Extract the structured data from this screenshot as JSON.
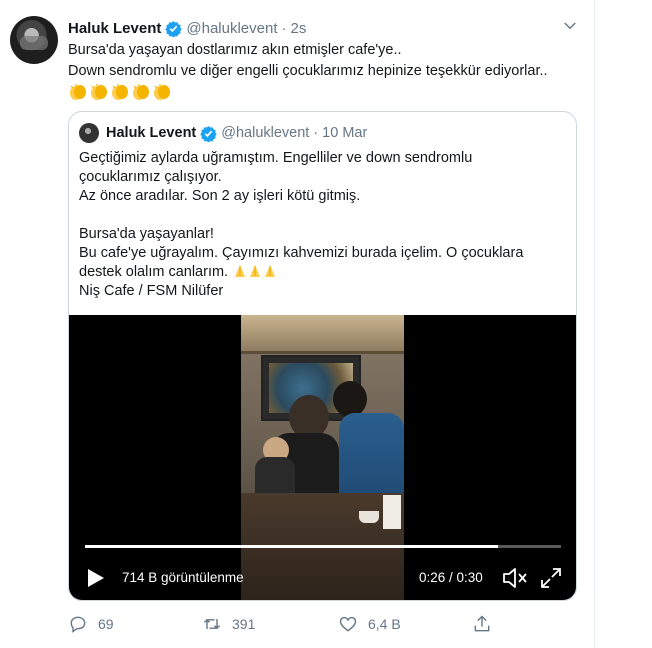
{
  "tweet": {
    "author_name": "Haluk Levent",
    "author_handle": "@haluklevent",
    "separator": "·",
    "time": "2s",
    "text_line1": "Bursa'da yaşayan dostlarımız akın etmişler cafe'ye..",
    "text_line2": "Down sendromlu ve diğer engelli çocuklarımız hepinize teşekkür ediyorlar..",
    "emoji_count": 5
  },
  "quote": {
    "author_name": "Haluk Levent",
    "author_handle": "@haluklevent",
    "separator": "·",
    "date": "10 Mar",
    "lines": [
      "Geçtiğimiz aylarda uğramıştım. Engelliler ve down sendromlu",
      "çocuklarımız çalışıyor.",
      "Az önce aradılar. Son 2 ay işleri kötü gitmiş.",
      "",
      "Bursa'da yaşayanlar!",
      "Bu cafe'ye uğrayalım. Çayımızı kahvemizi burada içelim. O çocuklara",
      "destek olalım canlarım.",
      "Niş Cafe / FSM Nilüfer"
    ],
    "video": {
      "views": "714 B görüntülenme",
      "time": "0:26 / 0:30",
      "progress": 0.867
    }
  },
  "actions": {
    "replies": "69",
    "retweets": "391",
    "likes": "6,4 B"
  },
  "colors": {
    "text": "#14171a",
    "muted": "#657786",
    "border": "#ccd6dd",
    "verified": "#1da1f2"
  }
}
